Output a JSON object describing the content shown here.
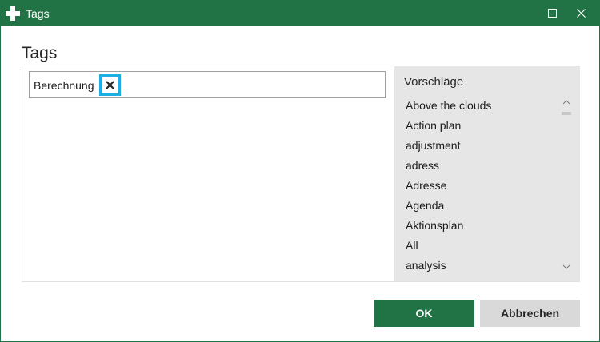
{
  "window": {
    "title": "Tags",
    "icons": {
      "app": "app-logo-icon",
      "maximize": "maximize-icon",
      "close": "close-icon"
    },
    "colors": {
      "titlebar": "#217346",
      "focus_ring": "#1eaee2"
    }
  },
  "heading": "Tags",
  "tags": [
    {
      "label": "Berechnung",
      "remove_icon": "remove-x-icon"
    }
  ],
  "suggestions": {
    "title": "Vorschläge",
    "items": [
      "Above the clouds",
      "Action plan",
      "adjustment",
      "adress",
      "Adresse",
      "Agenda",
      "Aktionsplan",
      "All",
      "analysis"
    ]
  },
  "buttons": {
    "ok": "OK",
    "cancel": "Abbrechen"
  }
}
